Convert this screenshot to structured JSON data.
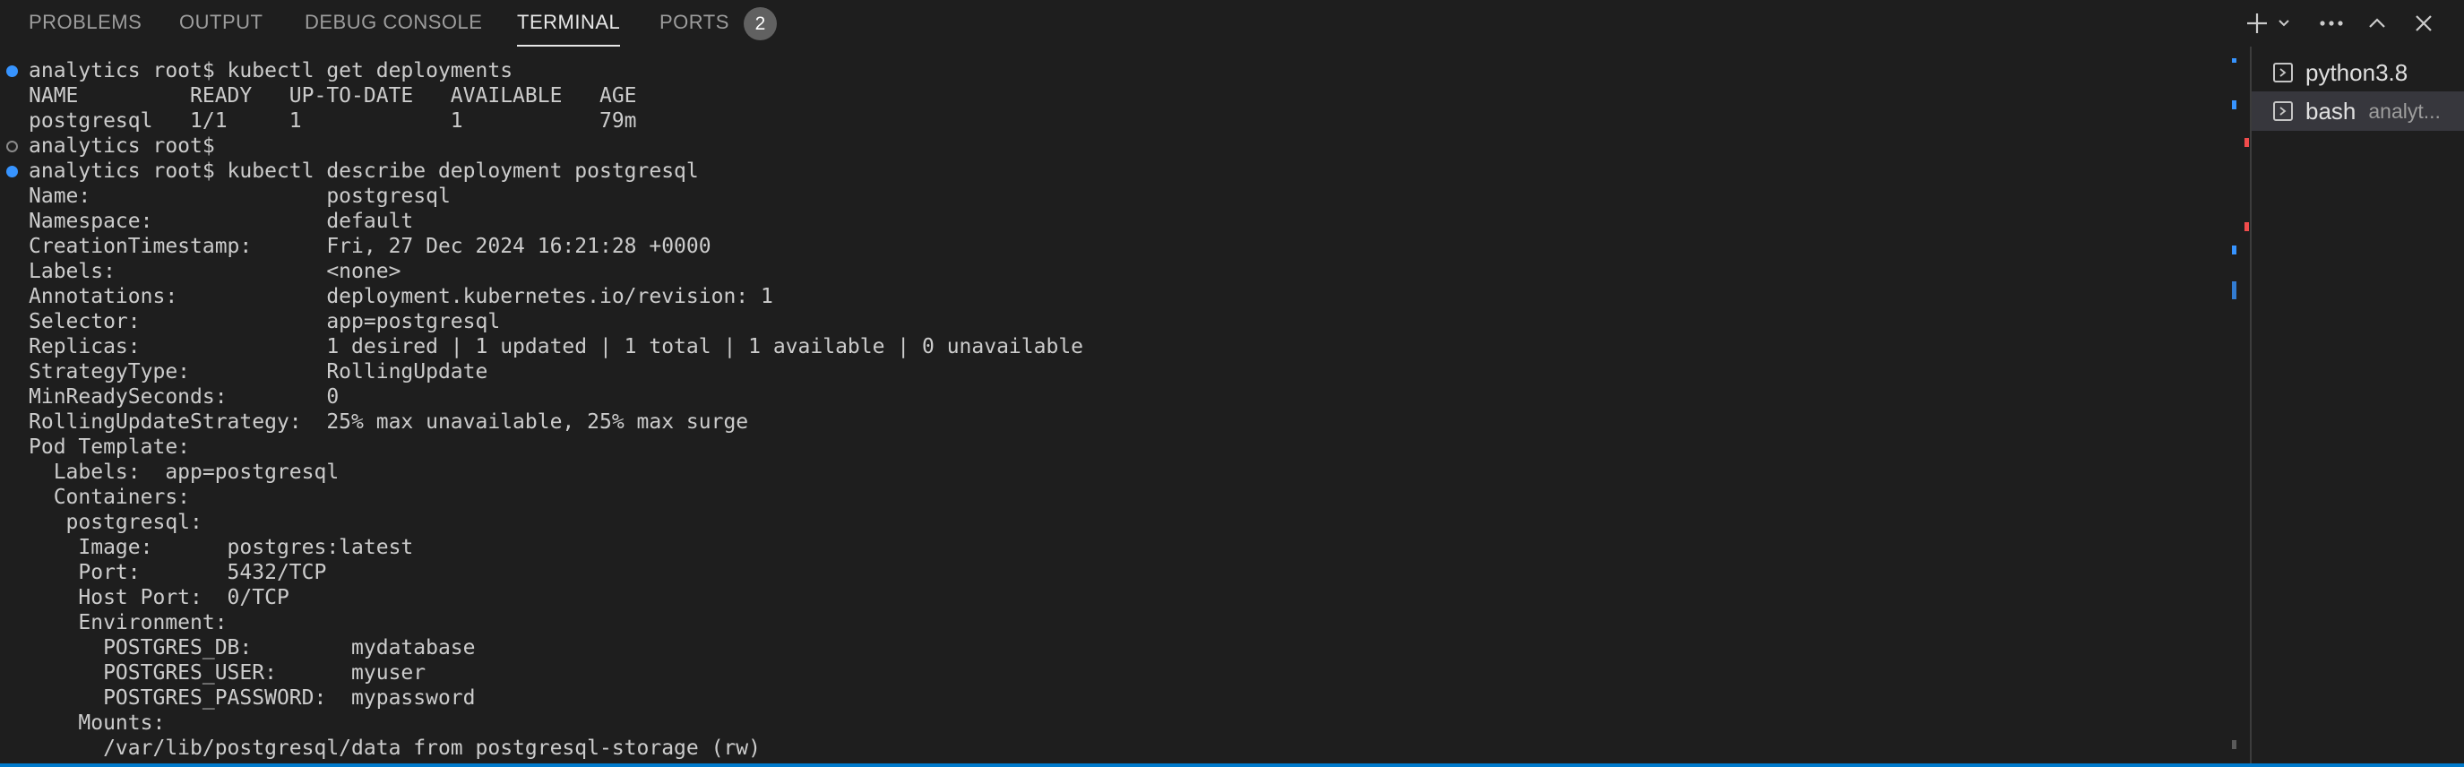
{
  "panel": {
    "tabs": [
      {
        "label": "PROBLEMS"
      },
      {
        "label": "OUTPUT"
      },
      {
        "label": "DEBUG CONSOLE"
      },
      {
        "label": "TERMINAL",
        "active": true
      },
      {
        "label": "PORTS",
        "badge": "2"
      }
    ],
    "toolbar_icons": [
      "plus-icon",
      "chevron-down-icon",
      "more-icon",
      "chevron-up-icon",
      "close-icon"
    ]
  },
  "terminal": {
    "lines": [
      {
        "text": "analytics root$ kubectl get deployments",
        "marker": "filled"
      },
      {
        "text": "NAME         READY   UP-TO-DATE   AVAILABLE   AGE"
      },
      {
        "text": "postgresql   1/1     1            1           79m"
      },
      {
        "text": "analytics root$",
        "marker": "hollow"
      },
      {
        "text": "analytics root$ kubectl describe deployment postgresql",
        "marker": "filled"
      },
      {
        "text": "Name:                   postgresql"
      },
      {
        "text": "Namespace:              default"
      },
      {
        "text": "CreationTimestamp:      Fri, 27 Dec 2024 16:21:28 +0000"
      },
      {
        "text": "Labels:                 <none>"
      },
      {
        "text": "Annotations:            deployment.kubernetes.io/revision: 1"
      },
      {
        "text": "Selector:               app=postgresql"
      },
      {
        "text": "Replicas:               1 desired | 1 updated | 1 total | 1 available | 0 unavailable"
      },
      {
        "text": "StrategyType:           RollingUpdate"
      },
      {
        "text": "MinReadySeconds:        0"
      },
      {
        "text": "RollingUpdateStrategy:  25% max unavailable, 25% max surge"
      },
      {
        "text": "Pod Template:"
      },
      {
        "text": "  Labels:  app=postgresql"
      },
      {
        "text": "  Containers:"
      },
      {
        "text": "   postgresql:"
      },
      {
        "text": "    Image:      postgres:latest"
      },
      {
        "text": "    Port:       5432/TCP"
      },
      {
        "text": "    Host Port:  0/TCP"
      },
      {
        "text": "    Environment:"
      },
      {
        "text": "      POSTGRES_DB:        mydatabase"
      },
      {
        "text": "      POSTGRES_USER:      myuser"
      },
      {
        "text": "      POSTGRES_PASSWORD:  mypassword"
      },
      {
        "text": "    Mounts:"
      },
      {
        "text": "      /var/lib/postgresql/data from postgresql-storage (rw)"
      }
    ]
  },
  "terminal_list": [
    {
      "name": "python3.8",
      "description": "",
      "selected": false
    },
    {
      "name": "bash",
      "description": "analyt...",
      "selected": true
    }
  ],
  "colors": {
    "background": "#1e1e1e",
    "text": "#cccccc",
    "marker_success": "#3794ff",
    "accent": "#007acc"
  }
}
